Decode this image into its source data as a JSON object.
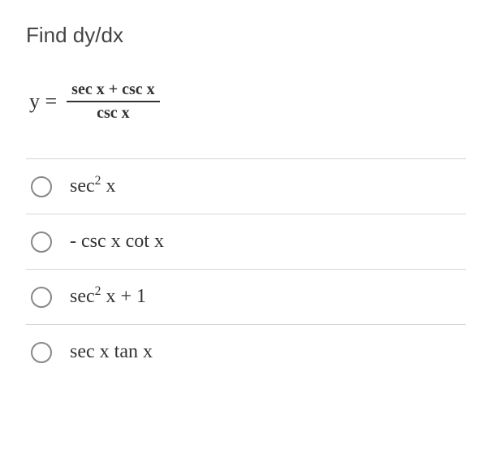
{
  "question": {
    "title": "Find dy/dx",
    "equation_left": "y =",
    "equation_numerator": "sec x + csc x",
    "equation_denominator": "csc x"
  },
  "options": [
    {
      "html": "sec<sup>2</sup> x"
    },
    {
      "html": "- csc x cot x"
    },
    {
      "html": "sec<sup>2</sup> x + 1"
    },
    {
      "html": "sec x tan x"
    }
  ]
}
